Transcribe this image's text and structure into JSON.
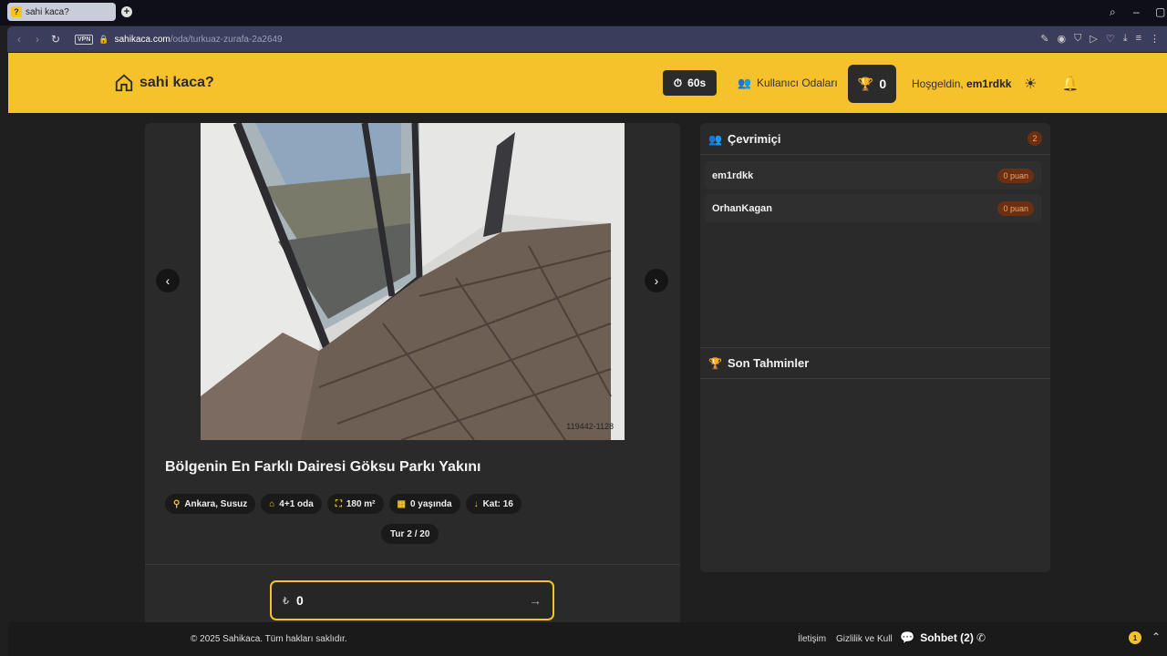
{
  "browser": {
    "tab_title": "sahi kaca?",
    "tab_favicon": "?",
    "new_tab": "+",
    "vpn_label": "VPN",
    "url_host": "sahikaca.com",
    "url_path": "/oda/turkuaz-zurafa-2a2649"
  },
  "header": {
    "logo_text": "sahi kaca?",
    "timer": "60s",
    "rooms_label": "Kullanıcı Odaları",
    "score": "0",
    "welcome_prefix": "Hoşgeldin,",
    "username": "em1rdkk"
  },
  "listing": {
    "photo_watermark": "119442-1128",
    "title": "Bölgenin En Farklı Dairesi Göksu Parkı Yakını",
    "chips": [
      {
        "icon": "map-pin-icon",
        "label": "Ankara, Susuz"
      },
      {
        "icon": "home-icon",
        "label": "4+1 oda"
      },
      {
        "icon": "area-icon",
        "label": "180 m²"
      },
      {
        "icon": "building-icon",
        "label": "0 yaşında"
      },
      {
        "icon": "arrow-down-icon",
        "label": "Kat: 16"
      }
    ],
    "round_prefix": "Tur",
    "round_value": "2 / 20"
  },
  "guess": {
    "currency": "₺",
    "value": "0"
  },
  "online": {
    "title": "Çevrimiçi",
    "count": "2",
    "users": [
      {
        "name": "em1rdkk",
        "points": "0 puan"
      },
      {
        "name": "OrhanKagan",
        "points": "0 puan"
      }
    ]
  },
  "recent": {
    "title": "Son Tahminler"
  },
  "footer": {
    "copyright": "© 2025 Sahikaca. Tüm hakları saklıdır.",
    "contact": "İletişim",
    "privacy": "Gizlilik ve Kull",
    "chat": "Sohbet (2)",
    "notifications": "1"
  },
  "colors": {
    "accent": "#f5c22b",
    "background": "#1f1f1f",
    "card": "#2a2a2a",
    "badge": "#6b2f12"
  }
}
